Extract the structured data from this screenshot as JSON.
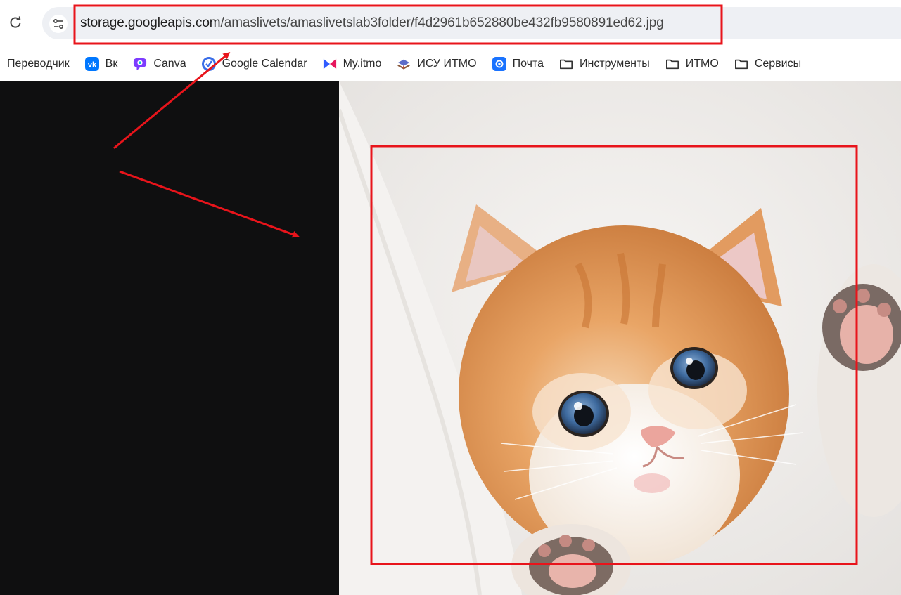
{
  "browser": {
    "url_host": "storage.googleapis.com",
    "url_path": "/amaslivets/amaslivetslab3folder/f4d2961b652880be432fb9580891ed62.jpg",
    "reload_icon": "reload-icon",
    "site_info_icon": "tune-icon"
  },
  "bookmarks": [
    {
      "label": "Переводчик",
      "icon": "translate-icon"
    },
    {
      "label": "Вк",
      "icon": "vk-icon"
    },
    {
      "label": "Canva",
      "icon": "canva-icon"
    },
    {
      "label": "Google Calendar",
      "icon": "calendar-icon"
    },
    {
      "label": "My.itmo",
      "icon": "myitmo-icon"
    },
    {
      "label": "ИСУ ИТМО",
      "icon": "isu-icon"
    },
    {
      "label": "Почта",
      "icon": "mail-icon"
    },
    {
      "label": "Инструменты",
      "icon": "folder-icon"
    },
    {
      "label": "ИТМО",
      "icon": "folder-icon"
    },
    {
      "label": "Сервисы",
      "icon": "folder-icon"
    }
  ],
  "content": {
    "image_subject": "kitten-photo",
    "viewer_background": "#0f0f10"
  },
  "annotations": {
    "color": "#e8141b"
  }
}
